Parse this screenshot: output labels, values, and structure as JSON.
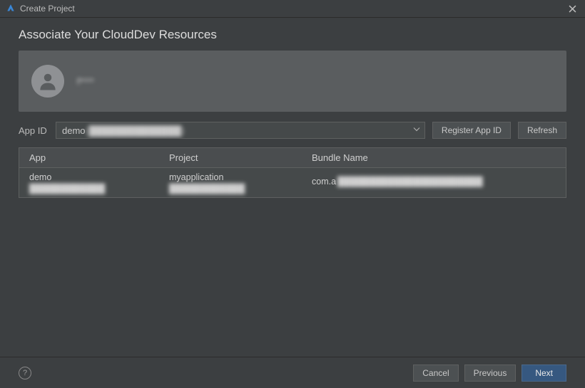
{
  "titlebar": {
    "title": "Create Project"
  },
  "page_title": "Associate Your CloudDev Resources",
  "user": {
    "name": "f****"
  },
  "appid": {
    "label": "App ID",
    "selected_prefix": "demo",
    "selected_obscured": "(██████████████)"
  },
  "buttons": {
    "register": "Register App ID",
    "refresh": "Refresh",
    "cancel": "Cancel",
    "previous": "Previous",
    "next": "Next"
  },
  "table": {
    "headers": {
      "app": "App",
      "project": "Project",
      "bundle": "Bundle Name"
    },
    "row": {
      "app_name": "demo",
      "app_sub": "████████████",
      "project_name": "myapplication",
      "project_sub": "████████████",
      "bundle_prefix": "com.a",
      "bundle_obscured": "███████████████████████"
    }
  }
}
